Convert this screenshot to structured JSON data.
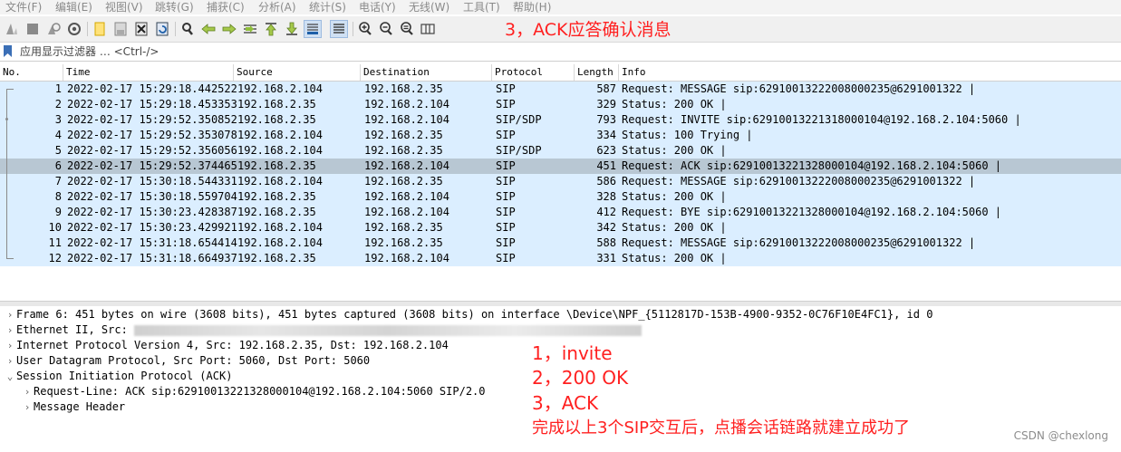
{
  "menu": [
    "文件(F)",
    "编辑(E)",
    "视图(V)",
    "跳转(G)",
    "捕获(C)",
    "分析(A)",
    "统计(S)",
    "电话(Y)",
    "无线(W)",
    "工具(T)",
    "帮助(H)"
  ],
  "toolbar": {
    "icons": [
      "shark-fin-start-icon",
      "stop-square-icon",
      "restart-capture-icon",
      "capture-options-gear-icon",
      "open-file-icon",
      "save-file-icon",
      "close-file-icon",
      "reload-file-icon",
      "find-packet-icon",
      "go-back-icon",
      "go-forward-icon",
      "go-to-packet-icon",
      "first-packet-icon",
      "last-packet-icon",
      "autoscroll-icon",
      "colorize-icon",
      "zoom-in-icon",
      "zoom-out-icon",
      "zoom-normal-icon",
      "resize-columns-icon"
    ]
  },
  "annotation_top": "3，ACK应答确认消息",
  "filter": {
    "placeholder": "应用显示过滤器 … <Ctrl-/>",
    "value": ""
  },
  "packet_list": {
    "columns": [
      "No.",
      "Time",
      "Source",
      "Destination",
      "Protocol",
      "Length",
      "Info"
    ],
    "rows": [
      {
        "no": "1",
        "time": "2022-02-17 15:29:18.442522",
        "src": "192.168.2.104",
        "dst": "192.168.2.35",
        "proto": "SIP",
        "len": "587",
        "info": "Request: MESSAGE sip:62910013222008000235@6291001322 |"
      },
      {
        "no": "2",
        "time": "2022-02-17 15:29:18.453353",
        "src": "192.168.2.35",
        "dst": "192.168.2.104",
        "proto": "SIP",
        "len": "329",
        "info": "Status: 200 OK |"
      },
      {
        "no": "3",
        "time": "2022-02-17 15:29:52.350852",
        "src": "192.168.2.35",
        "dst": "192.168.2.104",
        "proto": "SIP/SDP",
        "len": "793",
        "info": "Request: INVITE sip:62910013221318000104@192.168.2.104:5060 |"
      },
      {
        "no": "4",
        "time": "2022-02-17 15:29:52.353078",
        "src": "192.168.2.104",
        "dst": "192.168.2.35",
        "proto": "SIP",
        "len": "334",
        "info": "Status: 100 Trying |"
      },
      {
        "no": "5",
        "time": "2022-02-17 15:29:52.356056",
        "src": "192.168.2.104",
        "dst": "192.168.2.35",
        "proto": "SIP/SDP",
        "len": "623",
        "info": "Status: 200 OK |"
      },
      {
        "no": "6",
        "time": "2022-02-17 15:29:52.374465",
        "src": "192.168.2.35",
        "dst": "192.168.2.104",
        "proto": "SIP",
        "len": "451",
        "info": "Request: ACK sip:62910013221328000104@192.168.2.104:5060 |"
      },
      {
        "no": "7",
        "time": "2022-02-17 15:30:18.544331",
        "src": "192.168.2.104",
        "dst": "192.168.2.35",
        "proto": "SIP",
        "len": "586",
        "info": "Request: MESSAGE sip:62910013222008000235@6291001322 |"
      },
      {
        "no": "8",
        "time": "2022-02-17 15:30:18.559704",
        "src": "192.168.2.35",
        "dst": "192.168.2.104",
        "proto": "SIP",
        "len": "328",
        "info": "Status: 200 OK |"
      },
      {
        "no": "9",
        "time": "2022-02-17 15:30:23.428387",
        "src": "192.168.2.35",
        "dst": "192.168.2.104",
        "proto": "SIP",
        "len": "412",
        "info": "Request: BYE sip:62910013221328000104@192.168.2.104:5060 |"
      },
      {
        "no": "10",
        "time": "2022-02-17 15:30:23.429921",
        "src": "192.168.2.104",
        "dst": "192.168.2.35",
        "proto": "SIP",
        "len": "342",
        "info": "Status: 200 OK |"
      },
      {
        "no": "11",
        "time": "2022-02-17 15:31:18.654414",
        "src": "192.168.2.104",
        "dst": "192.168.2.35",
        "proto": "SIP",
        "len": "588",
        "info": "Request: MESSAGE sip:62910013222008000235@6291001322 |"
      },
      {
        "no": "12",
        "time": "2022-02-17 15:31:18.664937",
        "src": "192.168.2.35",
        "dst": "192.168.2.104",
        "proto": "SIP",
        "len": "331",
        "info": "Status: 200 OK |"
      }
    ],
    "selected_no": "6"
  },
  "details": [
    {
      "text": "Frame 6: 451 bytes on wire (3608 bits), 451 bytes captured (3608 bits) on interface \\Device\\NPF_{5112817D-153B-4900-9352-0C76F10E4FC1}, id 0",
      "expanded": false,
      "indent": 0
    },
    {
      "text": "Ethernet II, Src:",
      "expanded": false,
      "indent": 0,
      "blurred": true
    },
    {
      "text": "Internet Protocol Version 4, Src: 192.168.2.35, Dst: 192.168.2.104",
      "expanded": false,
      "indent": 0
    },
    {
      "text": "User Datagram Protocol, Src Port: 5060, Dst Port: 5060",
      "expanded": false,
      "indent": 0
    },
    {
      "text": "Session Initiation Protocol (ACK)",
      "expanded": true,
      "indent": 0
    },
    {
      "text": "Request-Line: ACK sip:62910013221328000104@192.168.2.104:5060 SIP/2.0",
      "expanded": false,
      "indent": 1
    },
    {
      "text": "Message Header",
      "expanded": false,
      "indent": 1
    }
  ],
  "annotations_bottom": [
    "1，invite",
    "2，200 OK",
    "3，ACK",
    "完成以上3个SIP交互后，点播会话链路就建立成功了"
  ],
  "watermark": "CSDN @chexlong",
  "colors": {
    "row_bg": "#dbeeff",
    "row_selected": "#b8c7d3",
    "annotation_red": "#ff2020"
  }
}
